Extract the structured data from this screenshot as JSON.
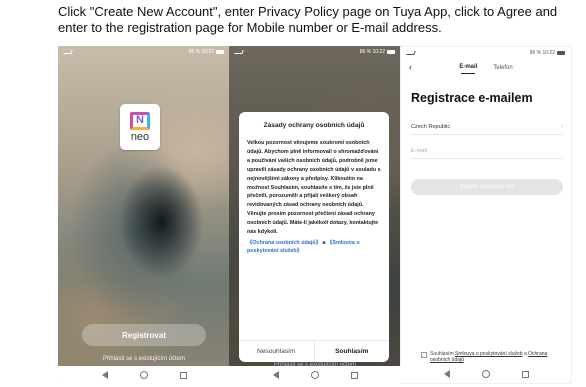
{
  "caption": "Click \"Create New Account\", enter Privacy Policy page on Tuya App, click to Agree and enter to the registration page for Mobile number or E-mail address.",
  "status_bar": {
    "right_text": "86 % 10:22"
  },
  "screen1": {
    "logo_text": "neo",
    "logo_mark": "N",
    "register_label": "Registrovat",
    "login_link": "Přihlásit se s existujícím účtem"
  },
  "screen2": {
    "dialog_title": "Zásady ochrany osobních údajů",
    "dialog_body": "Velkou pozornost věnujeme soukromí osobních údajů. Abychom plně informovali o shromažďování a používání vašich osobních údajů, podrobně jsme upravili zásady ochrany osobních údajů v souladu s nejnovějšími zákony a předpisy. Kliknutím na možnost Souhlasím, souhlasíte s tím, že jste plně přečetli, porozuměli a přijali veškerý obsah revidovaných zásad ochrany osobních údajů. Věnujte prosím pozornost přečtení zásad ochrany osobních údajů. Máte-li jakékoli dotazy, kontaktujte nás kdykoli.",
    "link_privacy": "《Ochrana osobních údajů》",
    "link_and": "a",
    "link_agreement": "《Smlouva o poskytování služeb》",
    "decline_label": "Nesouhlasím",
    "agree_label": "Souhlasím",
    "background_login": "Přihlásit se s existujícím účtem"
  },
  "screen3": {
    "back_icon": "‹",
    "tab_email": "E-mail",
    "tab_phone": "Telefon",
    "title": "Registrace e-mailem",
    "country_value": "Czech Republic",
    "email_placeholder": "E-mail",
    "code_button": "Načtěte ověřovací kód",
    "consent_prefix": "Souhlasím",
    "consent_link1": "Smlouva o poskytování služeb",
    "consent_and": "a",
    "consent_link2": "Ochrana osobních údajů"
  },
  "colors": {
    "accent_link": "#2a6fd6",
    "logo_magenta": "#c850b0",
    "logo_cyan": "#38b6e6",
    "logo_orange": "#ffb02e"
  }
}
